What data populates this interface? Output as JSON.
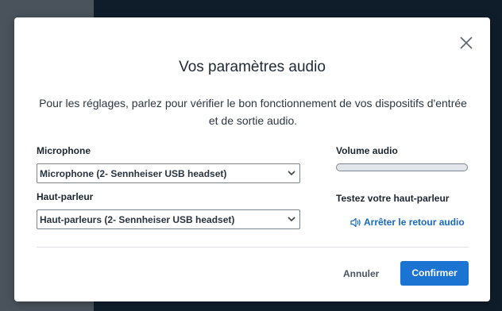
{
  "dialog": {
    "title": "Vos paramètres audio",
    "description": "Pour les réglages, parlez pour vérifier le bon fonctionnement de vos dispositifs d'entrée et de sortie audio.",
    "close_icon": "close-icon"
  },
  "microphone": {
    "label": "Microphone",
    "selected": "Microphone (2- Sennheiser USB headset)"
  },
  "speaker": {
    "label": "Haut-parleur",
    "selected": "Haut-parleurs (2- Sennheiser USB headset)"
  },
  "volume": {
    "label": "Volume audio",
    "level_percent": 0
  },
  "speaker_test": {
    "label": "Testez votre haut-parleur",
    "stop_label": "Arrêter le retour audio",
    "icon": "speaker-icon"
  },
  "footer": {
    "cancel_label": "Annuler",
    "confirm_label": "Confirmer"
  },
  "colors": {
    "accent": "#1b73d2",
    "link": "#1769c2"
  }
}
